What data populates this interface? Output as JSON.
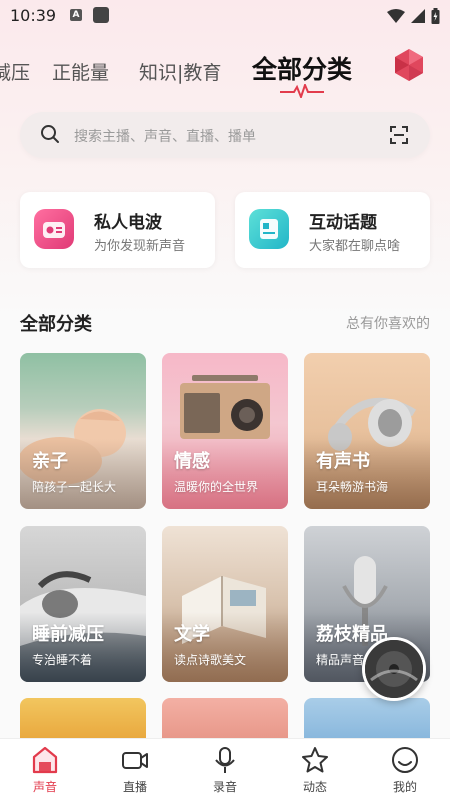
{
  "status_bar": {
    "time": "10:39",
    "a_badge": "A"
  },
  "top_tabs": [
    {
      "label": "减压"
    },
    {
      "label": "正能量"
    },
    {
      "label": "知识|教育"
    },
    {
      "label": "全部分类",
      "active": true
    }
  ],
  "search": {
    "placeholder": "搜索主播、声音、直播、播单"
  },
  "quick_cards": [
    {
      "title": "私人电波",
      "subtitle": "为你发现新声音",
      "color": "#f0568a"
    },
    {
      "title": "互动话题",
      "subtitle": "大家都在聊点啥",
      "color": "#36c9cc"
    }
  ],
  "section": {
    "title": "全部分类",
    "hint": "总有你喜欢的"
  },
  "categories": [
    {
      "title": "亲子",
      "subtitle": "陪孩子一起长大"
    },
    {
      "title": "情感",
      "subtitle": "温暖你的全世界"
    },
    {
      "title": "有声书",
      "subtitle": "耳朵畅游书海"
    },
    {
      "title": "睡前减压",
      "subtitle": "专治睡不着"
    },
    {
      "title": "文学",
      "subtitle": "读点诗歌美文"
    },
    {
      "title": "荔枝精品",
      "subtitle": "精品声音"
    }
  ],
  "bottom_nav": [
    {
      "label": "声音",
      "active": true
    },
    {
      "label": "直播"
    },
    {
      "label": "录音"
    },
    {
      "label": "动态"
    },
    {
      "label": "我的"
    }
  ],
  "colors": {
    "accent": "#e23b4c",
    "brand_pink": "#f0568a",
    "brand_teal": "#36c9cc"
  }
}
